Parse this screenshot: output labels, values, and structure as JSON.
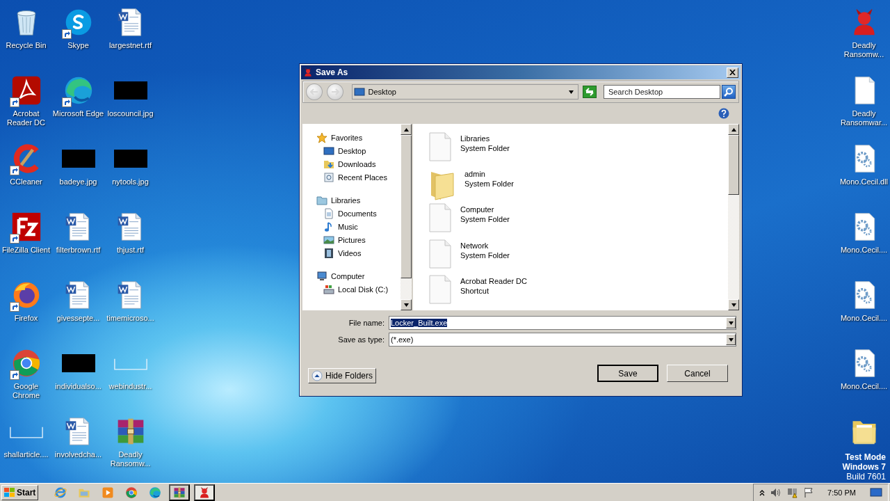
{
  "desktop": {
    "left_icons": [
      {
        "label": "Recycle Bin",
        "kind": "recycle",
        "shortcut": false
      },
      {
        "label": "Acrobat Reader DC",
        "kind": "acrobat",
        "shortcut": true
      },
      {
        "label": "CCleaner",
        "kind": "ccleaner",
        "shortcut": true
      },
      {
        "label": "FileZilla Client",
        "kind": "filezilla",
        "shortcut": true
      },
      {
        "label": "Firefox",
        "kind": "firefox",
        "shortcut": true
      },
      {
        "label": "Google Chrome",
        "kind": "chrome",
        "shortcut": true
      },
      {
        "label": "shallarticle....",
        "kind": "image-blank",
        "shortcut": false
      },
      {
        "label": "Skype",
        "kind": "skype",
        "shortcut": true
      },
      {
        "label": "Microsoft Edge",
        "kind": "edge",
        "shortcut": true
      },
      {
        "label": "badeye.jpg",
        "kind": "image-dark",
        "shortcut": false
      },
      {
        "label": "filterbrown.rtf",
        "kind": "word",
        "shortcut": false
      },
      {
        "label": "givessepte...",
        "kind": "word",
        "shortcut": false
      },
      {
        "label": "individualso...",
        "kind": "image-dark",
        "shortcut": false
      },
      {
        "label": "involvedcha...",
        "kind": "word",
        "shortcut": false
      },
      {
        "label": "largestnet.rtf",
        "kind": "word",
        "shortcut": false
      },
      {
        "label": "loscouncil.jpg",
        "kind": "image-dark",
        "shortcut": false
      },
      {
        "label": "nytools.jpg",
        "kind": "image-dark",
        "shortcut": false
      },
      {
        "label": "thjust.rtf",
        "kind": "word",
        "shortcut": false
      },
      {
        "label": "timemicroso...",
        "kind": "word",
        "shortcut": false
      },
      {
        "label": "webindustr...",
        "kind": "image-blank",
        "shortcut": false
      },
      {
        "label": "Deadly Ransomw...",
        "kind": "winrar",
        "shortcut": false
      }
    ],
    "right_icons": [
      {
        "label": "Deadly Ransomw...",
        "kind": "devil",
        "shortcut": false
      },
      {
        "label": "Deadly Ransomwar...",
        "kind": "blank-doc",
        "shortcut": false
      },
      {
        "label": "Mono.Cecil.dll",
        "kind": "gear-doc",
        "shortcut": false
      },
      {
        "label": "Mono.Cecil....",
        "kind": "gear-doc",
        "shortcut": false
      },
      {
        "label": "Mono.Cecil....",
        "kind": "gear-doc",
        "shortcut": false
      },
      {
        "label": "Mono.Cecil....",
        "kind": "gear-doc",
        "shortcut": false
      },
      {
        "kind": "folder",
        "shortcut": false
      }
    ]
  },
  "dialog": {
    "title": "Save As",
    "address": "Desktop",
    "search": {
      "placeholder": "Search Desktop"
    },
    "tree": [
      {
        "label": "Favorites",
        "kind": "star",
        "children": [
          {
            "label": "Desktop",
            "kind": "desktop"
          },
          {
            "label": "Downloads",
            "kind": "downloads"
          },
          {
            "label": "Recent Places",
            "kind": "recent"
          }
        ]
      },
      {
        "label": "Libraries",
        "kind": "library",
        "children": [
          {
            "label": "Documents",
            "kind": "documents"
          },
          {
            "label": "Music",
            "kind": "music"
          },
          {
            "label": "Pictures",
            "kind": "pictures"
          },
          {
            "label": "Videos",
            "kind": "videos"
          }
        ]
      },
      {
        "label": "Computer",
        "kind": "computer",
        "children": [
          {
            "label": "Local Disk (C:)",
            "kind": "disk"
          }
        ]
      }
    ],
    "files": [
      {
        "name": "Libraries",
        "type": "System Folder",
        "kind": "blank"
      },
      {
        "name": "admin",
        "type": "System Folder",
        "kind": "folder"
      },
      {
        "name": "Computer",
        "type": "System Folder",
        "kind": "blank"
      },
      {
        "name": "Network",
        "type": "System Folder",
        "kind": "blank"
      },
      {
        "name": "Acrobat Reader DC",
        "type": "Shortcut",
        "kind": "blank"
      }
    ],
    "file_name": {
      "label": "File name:",
      "value": "Locker_Built.exe",
      "text_selected": true
    },
    "save_type": {
      "label": "Save as type:",
      "value": "(*.exe)"
    },
    "hide_folders": "Hide Folders",
    "buttons": [
      {
        "label": "Save",
        "default": true
      },
      {
        "label": "Cancel",
        "default": false
      }
    ]
  },
  "taskbar": {
    "start": "Start",
    "items": [
      {
        "kind": "ie",
        "running": false,
        "selected": false
      },
      {
        "kind": "explorer",
        "running": false,
        "selected": false
      },
      {
        "kind": "media",
        "running": false,
        "selected": false
      },
      {
        "kind": "chrome",
        "running": false,
        "selected": false
      },
      {
        "kind": "edge",
        "running": false,
        "selected": false
      },
      {
        "kind": "winrar",
        "running": true,
        "selected": false
      },
      {
        "kind": "devil",
        "running": true,
        "selected": true
      }
    ],
    "clock": "7:50 PM"
  },
  "watermark": [
    "Test Mode",
    "Windows 7",
    "Build 7601"
  ]
}
